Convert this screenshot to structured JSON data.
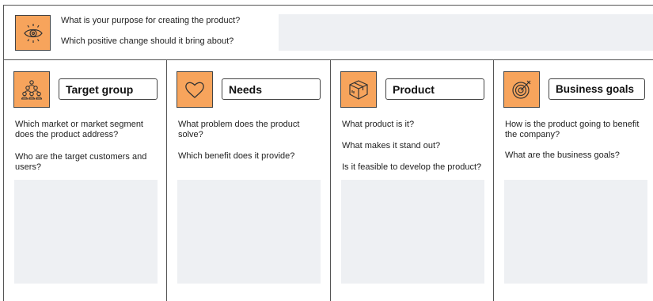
{
  "vision": {
    "icon": "eye-icon",
    "questions": [
      "What is your purpose for creating the product?",
      "Which positive change should it bring about?"
    ]
  },
  "columns": [
    {
      "title": "Target group",
      "icon": "people-group-icon",
      "questions": [
        "Which market or market segment does the product address?",
        "Who are the target customers and users?"
      ]
    },
    {
      "title": "Needs",
      "icon": "heart-icon",
      "questions": [
        "What problem does the product solve?",
        "Which benefit does it provide?"
      ]
    },
    {
      "title": "Product",
      "icon": "box-icon",
      "questions": [
        "What product is it?",
        "What makes it stand out?",
        "Is it feasible to develop the product?"
      ]
    },
    {
      "title": "Business goals",
      "icon": "target-icon",
      "questions": [
        "How is the product going to benefit the company?",
        "What are the business goals?"
      ]
    }
  ],
  "colors": {
    "accent": "#f7a45c",
    "note_background": "#eef0f3",
    "border": "#555555"
  }
}
